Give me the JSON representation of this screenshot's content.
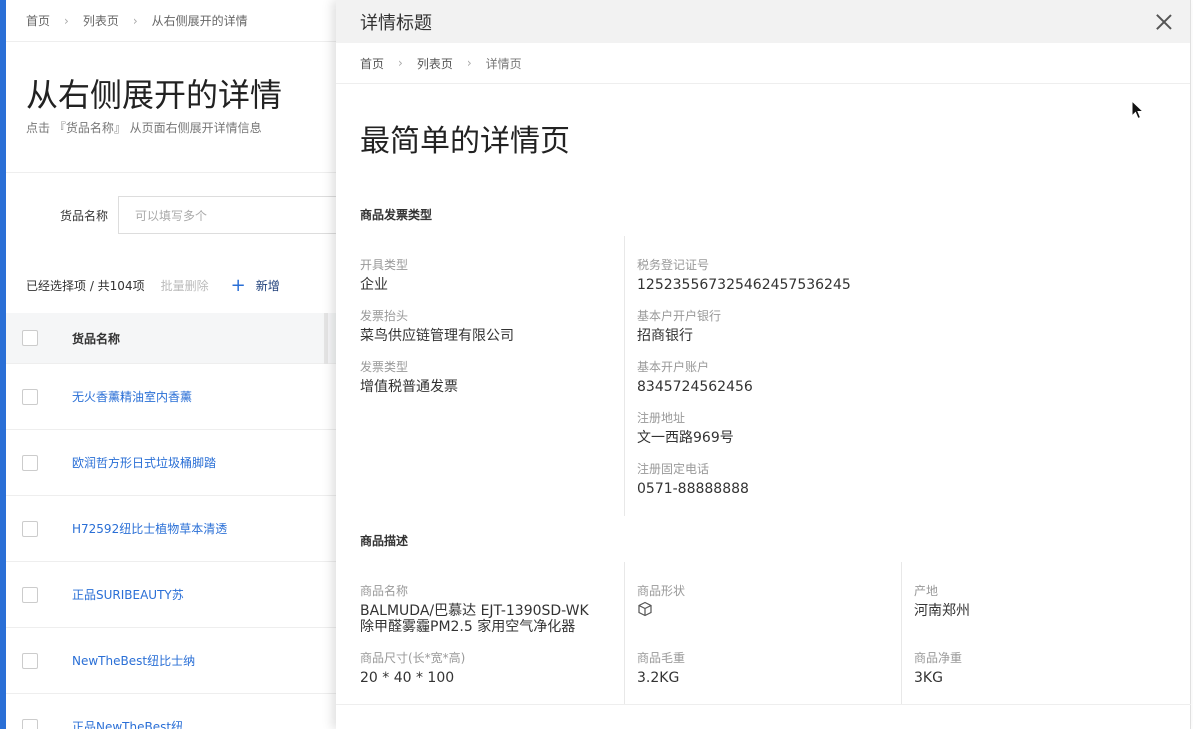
{
  "background_page": {
    "breadcrumb": [
      "首页",
      "列表页",
      "从右侧展开的详情"
    ],
    "breadcrumb_sep": "›",
    "title": "从右侧展开的详情",
    "subtitle": "点击 『货品名称』 从页面右侧展开详情信息",
    "filter": {
      "label": "货品名称",
      "placeholder": "可以填写多个"
    },
    "toolbar": {
      "count_text": "已经选择项 / 共104项",
      "batch_delete": "批量删除",
      "add": "新增",
      "add_icon": "plus-icon"
    },
    "table": {
      "header": "货品名称",
      "rows": [
        "无火香薰精油室内香薰",
        "欧润哲方形日式垃圾桶脚踏",
        "H72592纽比士植物草本清透",
        "正品SURIBEAUTY苏",
        "NewTheBest纽比士纳",
        "正品NewTheBest纽"
      ]
    }
  },
  "drawer": {
    "title": "详情标题",
    "close_icon": "close-icon",
    "breadcrumb": [
      "首页",
      "列表页",
      "详情页"
    ],
    "breadcrumb_sep": "›",
    "page_title": "最简单的详情页",
    "section1": {
      "title": "商品发票类型",
      "left": [
        {
          "label": "开具类型",
          "value": "企业"
        },
        {
          "label": "发票抬头",
          "value": "菜鸟供应链管理有限公司"
        },
        {
          "label": "发票类型",
          "value": "增值税普通发票"
        }
      ],
      "right": [
        {
          "label": "税务登记证号",
          "value": "1252355673254624575362​45"
        },
        {
          "label": "基本户开户银行",
          "value": "招商银行"
        },
        {
          "label": "基本开户账户",
          "value": "8345724562456"
        },
        {
          "label": "注册地址",
          "value": "文一西路969号"
        },
        {
          "label": "注册固定电话",
          "value": "0571-88888888"
        }
      ]
    },
    "section2": {
      "title": "商品描述",
      "name_label": "商品名称",
      "name_value_line1": "BALMUDA/巴慕达 EJT-1390SD-WK",
      "name_value_line2": "除甲醛雾霾PM2.5 家用空气净化器",
      "shape_label": "商品形状",
      "shape_icon": "cube-icon",
      "origin_label": "产地",
      "origin_value": "河南郑州",
      "size_label": "商品尺寸(长*宽*高)",
      "size_value": "20 * 40 * 100",
      "gross_label": "商品毛重",
      "gross_value": "3.2KG",
      "net_label": "商品净重",
      "net_value": "3KG"
    }
  },
  "colors": {
    "accent": "#2a6fd6",
    "link": "#2a6fd6"
  }
}
